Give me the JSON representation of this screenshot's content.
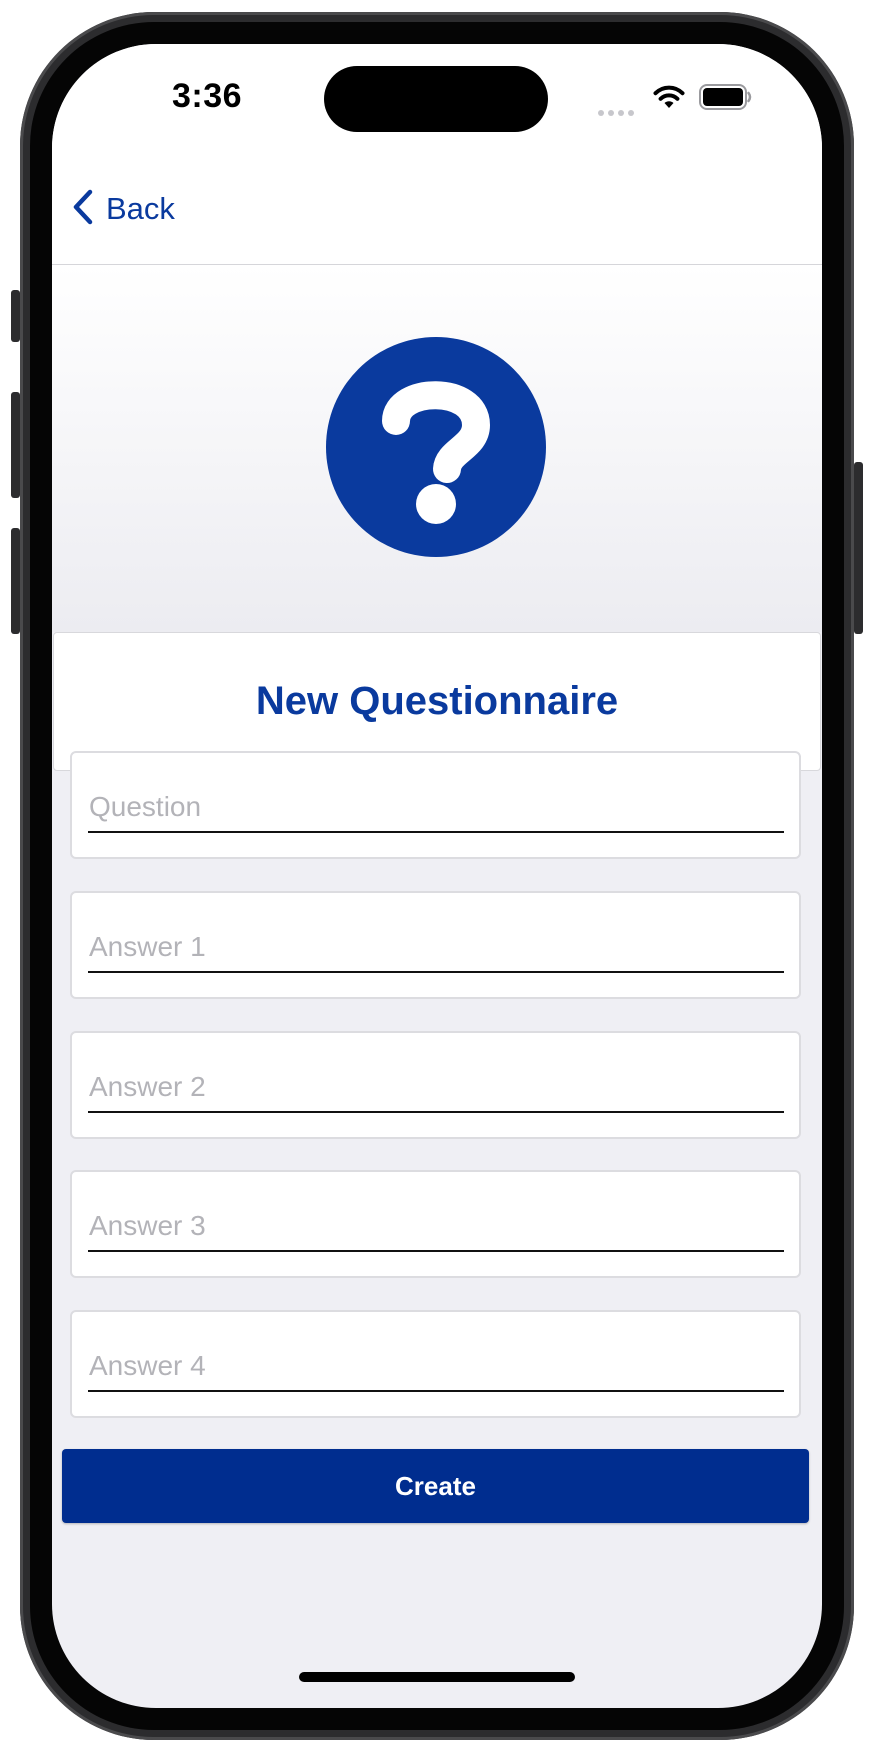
{
  "status_bar": {
    "time": "3:36"
  },
  "nav": {
    "back_label": "Back"
  },
  "header": {
    "title": "New Questionnaire"
  },
  "form": {
    "fields": [
      {
        "placeholder": "Question",
        "value": ""
      },
      {
        "placeholder": "Answer 1",
        "value": ""
      },
      {
        "placeholder": "Answer 2",
        "value": ""
      },
      {
        "placeholder": "Answer 3",
        "value": ""
      },
      {
        "placeholder": "Answer 4",
        "value": ""
      }
    ],
    "create_label": "Create"
  },
  "icons": {
    "hero": "question-circle-icon",
    "back": "chevron-left-icon",
    "signal": "cellular-signal-icon",
    "wifi": "wifi-icon",
    "battery": "battery-icon"
  },
  "colors": {
    "accent": "#0a3a9e",
    "button": "#002d8f",
    "background": "#efeff4"
  }
}
